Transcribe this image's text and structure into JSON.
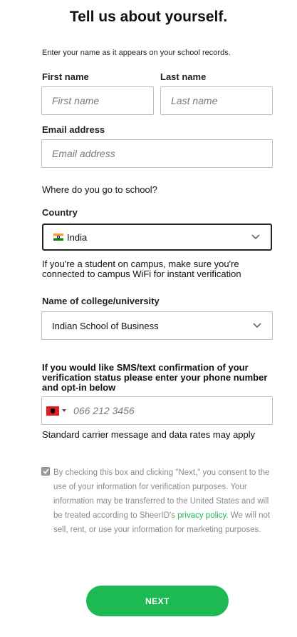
{
  "heading": "Tell us about yourself.",
  "intro": "Enter your name as it appears on your school records.",
  "first_name": {
    "label": "First name",
    "placeholder": "First name"
  },
  "last_name": {
    "label": "Last name",
    "placeholder": "Last name"
  },
  "email": {
    "label": "Email address",
    "placeholder": "Email address"
  },
  "school_question": "Where do you go to school?",
  "country": {
    "label": "Country",
    "value": "India",
    "flag": "india-flag-icon"
  },
  "campus_note": "If you're a student on campus, make sure you're connected to campus WiFi for instant verification",
  "college": {
    "label": "Name of college/university",
    "value": "Indian School of Business"
  },
  "sms_note": "If you would like SMS/text confirmation of your verification status please enter your phone number and opt-in below",
  "phone": {
    "placeholder": "066 212 3456",
    "flag": "albania-flag-icon"
  },
  "carrier_note": "Standard carrier message and data rates may apply",
  "consent": {
    "checked": true,
    "text_before": "By checking this box and clicking \"Next,\" you consent to the use of your information for verification purposes. Your information may be transferred to the United States and will be treated according to SheerID's ",
    "link": "privacy policy",
    "text_after": ". We will not sell, rent, or use your information for marketing purposes."
  },
  "next_label": "NEXT",
  "colors": {
    "accent": "#1db954",
    "border": "#bdbdbd",
    "muted": "#8a8a8a"
  }
}
